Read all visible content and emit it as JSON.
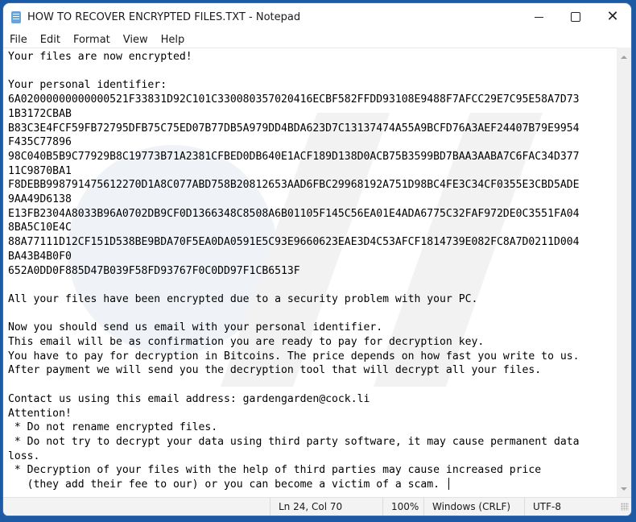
{
  "window": {
    "title": "HOW TO RECOVER ENCRYPTED FILES.TXT - Notepad",
    "icons": {
      "app": "notepad-icon",
      "minimize": "minimize-icon",
      "maximize": "maximize-icon",
      "close": "close-icon"
    }
  },
  "menu": [
    {
      "label": "File"
    },
    {
      "label": "Edit"
    },
    {
      "label": "Format"
    },
    {
      "label": "View"
    },
    {
      "label": "Help"
    }
  ],
  "document": {
    "lines": [
      "Your files are now encrypted!",
      "",
      "Your personal identifier:",
      "6A02000000000000521F33831D92C101C330080357020416ECBF582FFDD93108E9488F7AFCC29E7C95E58A7D73",
      "1B3172CBAB",
      "B83C3E4FCF59FB72795DFB75C75ED07B77DB5A979DD4BDA623D7C13137474A55A9BCFD76A3AEF24407B79E9954",
      "F435C77896",
      "98C040B5B9C77929B8C19773B71A2381CFBED0DB640E1ACF189D138D0ACB75B3599BD7BAA3AABA7C6FAC34D377",
      "11C9870BA1",
      "F8DEBB998791475612270D1A8C077ABD758B20812653AAD6FBC29968192A751D98BC4FE3C34CF0355E3CBD5ADE",
      "9AA49D6138",
      "E13FB2304A8033B96A0702DB9CF0D1366348C8508A6B01105F145C56EA01E4ADA6775C32FAF972DE0C3551FA04",
      "8BA5C10E4C",
      "88A77111D12CF151D538BE9BDA70F5EA0DA0591E5C93E9660623EAE3D4C53AFCF1814739E082FC8A7D0211D004",
      "BA43B4B0F0",
      "652A0DD0F885D47B039F58FD93767F0C0DD97F1CB6513F",
      "",
      "All your files have been encrypted due to a security problem with your PC.",
      "",
      "Now you should send us email with your personal identifier.",
      "This email will be as confirmation you are ready to pay for decryption key.",
      "You have to pay for decryption in Bitcoins. The price depends on how fast you write to us.",
      "After payment we will send you the decryption tool that will decrypt all your files.",
      "",
      "Contact us using this email address: gardengarden@cock.li",
      "Attention!",
      " * Do not rename encrypted files.",
      " * Do not try to decrypt your data using third party software, it may cause permanent data",
      "loss.",
      " * Decryption of your files with the help of third parties may cause increased price",
      "   (they add their fee to our) or you can become a victim of a scam. "
    ]
  },
  "statusbar": {
    "position": "Ln 24, Col 70",
    "zoom": "100%",
    "line_ending": "Windows (CRLF)",
    "encoding": "UTF-8"
  }
}
